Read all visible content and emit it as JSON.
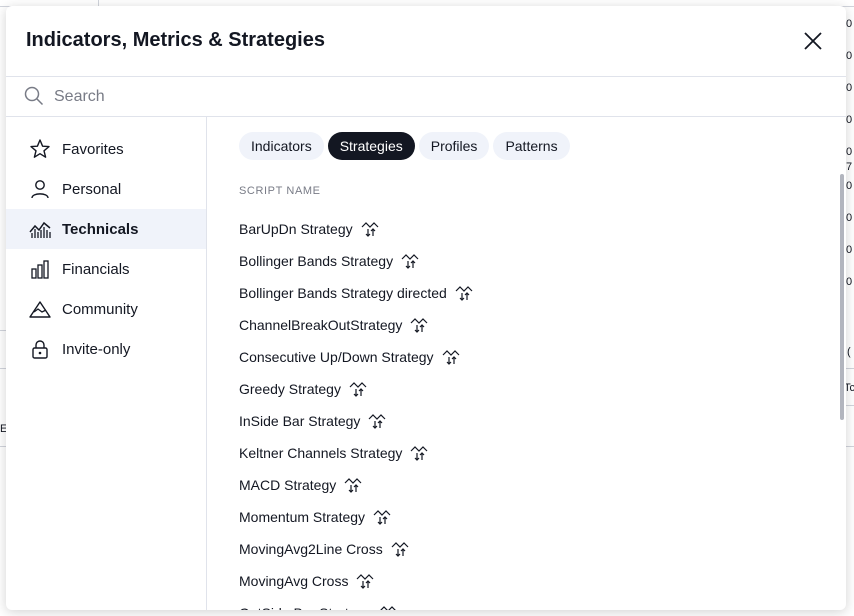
{
  "background": {
    "ticks": [
      "0",
      "0",
      "0",
      "0",
      "0",
      "7",
      "0",
      "0",
      "0",
      "0",
      "(",
      "Tc",
      "E"
    ]
  },
  "modal": {
    "title": "Indicators, Metrics & Strategies",
    "close_icon": "close-icon"
  },
  "search": {
    "placeholder": "Search",
    "value": ""
  },
  "sidebar": {
    "items": [
      {
        "label": "Favorites",
        "icon": "star-icon",
        "active": false
      },
      {
        "label": "Personal",
        "icon": "user-icon",
        "active": false
      },
      {
        "label": "Technicals",
        "icon": "chart-area-icon",
        "active": true
      },
      {
        "label": "Financials",
        "icon": "bar-chart-icon",
        "active": false
      },
      {
        "label": "Community",
        "icon": "community-icon",
        "active": false
      },
      {
        "label": "Invite-only",
        "icon": "lock-icon",
        "active": false
      }
    ]
  },
  "tabs": [
    {
      "label": "Indicators",
      "active": false
    },
    {
      "label": "Strategies",
      "active": true
    },
    {
      "label": "Profiles",
      "active": false
    },
    {
      "label": "Patterns",
      "active": false
    }
  ],
  "list": {
    "header": "SCRIPT NAME",
    "items": [
      "BarUpDn Strategy",
      "Bollinger Bands Strategy",
      "Bollinger Bands Strategy directed",
      "ChannelBreakOutStrategy",
      "Consecutive Up/Down Strategy",
      "Greedy Strategy",
      "InSide Bar Strategy",
      "Keltner Channels Strategy",
      "MACD Strategy",
      "Momentum Strategy",
      "MovingAvg2Line Cross",
      "MovingAvg Cross",
      "OutSide Bar Strategy"
    ]
  },
  "colors": {
    "accent_dark": "#131722",
    "muted": "#787b86",
    "active_bg": "#f0f3fa",
    "border": "#e0e3eb"
  }
}
